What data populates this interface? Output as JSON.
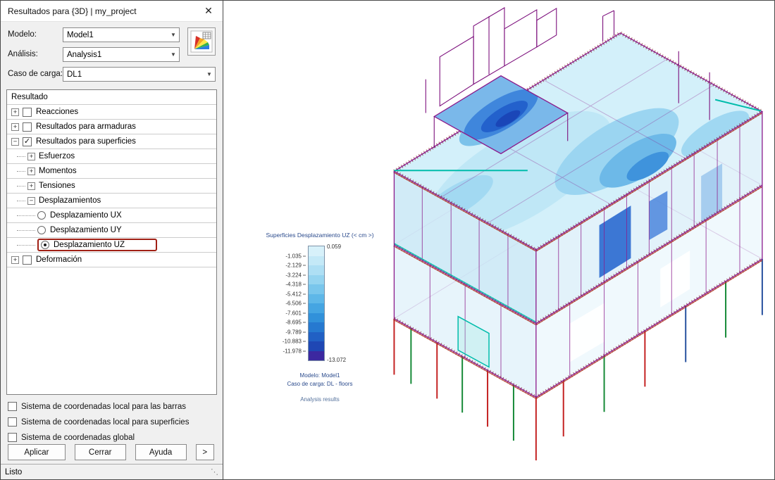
{
  "dialog": {
    "title": "Resultados para {3D} | my_project",
    "status_text": "Listo",
    "form": {
      "model_label": "Modelo:",
      "model_value": "Model1",
      "analysis_label": "Análisis:",
      "analysis_value": "Analysis1",
      "load_case_label": "Caso de carga:",
      "load_case_value": "DL1"
    },
    "tree": {
      "items": [
        {
          "label": "Resultado",
          "header": true
        },
        {
          "label": "Reacciones",
          "expand": "plus",
          "check": false,
          "indent": 0
        },
        {
          "label": "Resultados para armaduras",
          "expand": "plus",
          "check": false,
          "indent": 0
        },
        {
          "label": "Resultados para superficies",
          "expand": "minus",
          "check": true,
          "indent": 0
        },
        {
          "label": "Esfuerzos",
          "expand": "plus",
          "indent": 1
        },
        {
          "label": "Momentos",
          "expand": "plus",
          "indent": 1
        },
        {
          "label": "Tensiones",
          "expand": "plus",
          "indent": 1
        },
        {
          "label": "Desplazamientos",
          "expand": "minus",
          "indent": 1
        },
        {
          "label": "Desplazamiento UX",
          "radio": false,
          "indent": 2
        },
        {
          "label": "Desplazamiento UY",
          "radio": false,
          "indent": 2
        },
        {
          "label": "Desplazamiento UZ",
          "radio": true,
          "indent": 2,
          "highlight": true
        },
        {
          "label": "Deformación",
          "expand": "plus",
          "check": false,
          "indent": 0
        }
      ]
    },
    "coord_options": [
      "Sistema de coordenadas local para las barras",
      "Sistema de coordenadas local para superficies",
      "Sistema de coordenadas global"
    ],
    "buttons": {
      "apply": "Aplicar",
      "close": "Cerrar",
      "help": "Ayuda",
      "more": ">"
    }
  },
  "legend": {
    "title": "Superficies Desplazamiento UZ (< cm >)",
    "max_value": "0.059",
    "min_value": "-13.072",
    "tick_values": [
      "-1.035",
      "-2.129",
      "-3.224",
      "-4.318",
      "-5.412",
      "-6.506",
      "-7.601",
      "-8.695",
      "-9.789",
      "-10.883",
      "-11.978"
    ],
    "colors": [
      "#d7f1fa",
      "#c4e9f7",
      "#aedff4",
      "#95d4f0",
      "#79c6ec",
      "#5eb7e8",
      "#45a5e2",
      "#3191da",
      "#2679d0",
      "#2160c4",
      "#1f47b4",
      "#3c28a0"
    ],
    "model_line": "Modelo: Model1",
    "case_line": "Caso de carga: DL - floors",
    "analysis_line": "Analysis results"
  }
}
